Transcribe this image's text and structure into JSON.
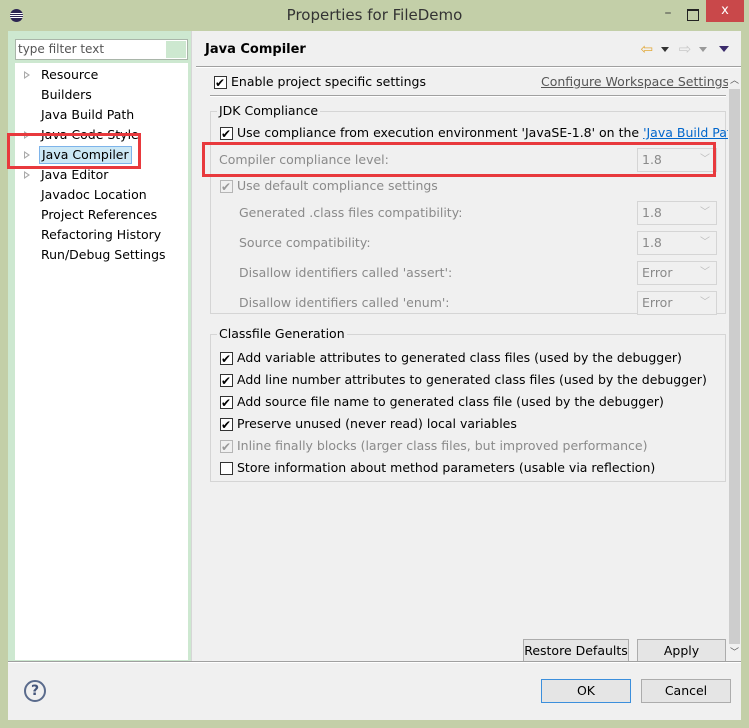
{
  "window": {
    "title": "Properties for FileDemo",
    "minimize": "–",
    "close": "x"
  },
  "sidebar": {
    "filter_placeholder": "type filter text",
    "items": [
      {
        "label": "Resource",
        "expandable": true,
        "selected": false
      },
      {
        "label": "Builders",
        "expandable": false,
        "selected": false
      },
      {
        "label": "Java Build Path",
        "expandable": false,
        "selected": false
      },
      {
        "label": "Java Code Style",
        "expandable": true,
        "selected": false
      },
      {
        "label": "Java Compiler",
        "expandable": true,
        "selected": true
      },
      {
        "label": "Java Editor",
        "expandable": true,
        "selected": false
      },
      {
        "label": "Javadoc Location",
        "expandable": false,
        "selected": false
      },
      {
        "label": "Project References",
        "expandable": false,
        "selected": false
      },
      {
        "label": "Refactoring History",
        "expandable": false,
        "selected": false
      },
      {
        "label": "Run/Debug Settings",
        "expandable": false,
        "selected": false
      }
    ]
  },
  "page": {
    "title": "Java Compiler",
    "nav": {
      "back": "⇦",
      "forward": "⇨"
    },
    "enable_project_settings": {
      "label": "Enable project specific settings",
      "checked": true
    },
    "configure_workspace_link": "Configure Workspace Settings...",
    "jdk_compliance": {
      "title": "JDK Compliance",
      "use_exec_env": {
        "label_prefix": "Use compliance from execution environment 'JavaSE-1.8' on the ",
        "link": "'Java Build Path'",
        "checked": true
      },
      "compliance_level": {
        "label": "Compiler compliance level:",
        "value": "1.8"
      },
      "use_default": {
        "label": "Use default compliance settings",
        "checked": true
      },
      "rows": [
        {
          "label": "Generated .class files compatibility:",
          "value": "1.8"
        },
        {
          "label": "Source compatibility:",
          "value": "1.8"
        },
        {
          "label": "Disallow identifiers called 'assert':",
          "value": "Error"
        },
        {
          "label": "Disallow identifiers called 'enum':",
          "value": "Error"
        }
      ]
    },
    "classfile_generation": {
      "title": "Classfile Generation",
      "options": [
        {
          "label": "Add variable attributes to generated class files (used by the debugger)",
          "checked": true,
          "disabled": false
        },
        {
          "label": "Add line number attributes to generated class files (used by the debugger)",
          "checked": true,
          "disabled": false
        },
        {
          "label": "Add source file name to generated class file (used by the debugger)",
          "checked": true,
          "disabled": false
        },
        {
          "label": "Preserve unused (never read) local variables",
          "checked": true,
          "disabled": false
        },
        {
          "label": "Inline finally blocks (larger class files, but improved performance)",
          "checked": true,
          "disabled": true
        },
        {
          "label": "Store information about method parameters (usable via reflection)",
          "checked": false,
          "disabled": false
        }
      ]
    },
    "restore_defaults": "Restore Defaults",
    "apply": "Apply"
  },
  "footer": {
    "help": "?",
    "ok": "OK",
    "cancel": "Cancel"
  },
  "colors": {
    "annotation": "#e8393d",
    "link": "#0066cc",
    "selection": "#cce8f5"
  }
}
